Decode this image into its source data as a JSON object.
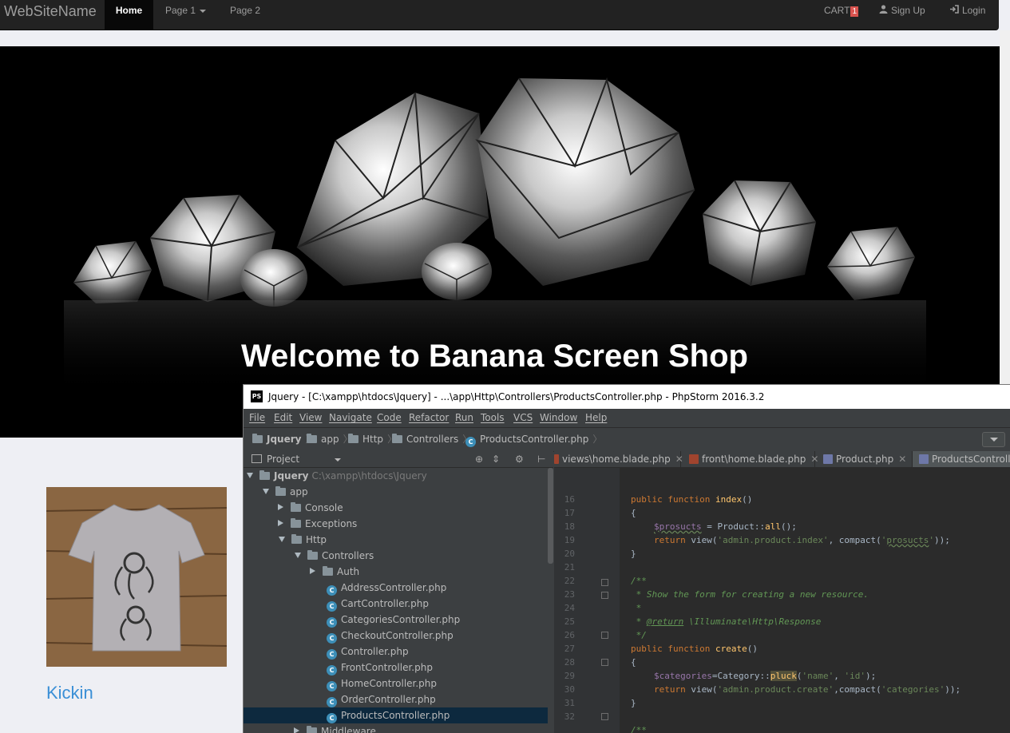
{
  "navbar": {
    "brand": "WebSiteName",
    "items": [
      "Home",
      "Page 1",
      "Page 2"
    ],
    "cart_label": "CART",
    "cart_count": "1",
    "signup": "Sign Up",
    "login": "Login"
  },
  "hero": {
    "title": "Welcome to Banana Screen Shop"
  },
  "product": {
    "name": "Kickin"
  },
  "ide": {
    "title": "Jquery - [C:\\xampp\\htdocs\\Jquery] - ...\\app\\Http\\Controllers\\ProductsController.php - PhpStorm 2016.3.2",
    "logo": "PS",
    "menu": [
      "File",
      "Edit",
      "View",
      "Navigate",
      "Code",
      "Refactor",
      "Run",
      "Tools",
      "VCS",
      "Window",
      "Help"
    ],
    "breadcrumb": [
      "Jquery",
      "app",
      "Http",
      "Controllers",
      "ProductsController.php"
    ],
    "project_label": "Project",
    "tabs": [
      "views\\home.blade.php",
      "front\\home.blade.php",
      "Product.php",
      "ProductsController"
    ],
    "tree": {
      "root": "Jquery",
      "root_path": "C:\\xampp\\htdocs\\Jquery",
      "app": "app",
      "console": "Console",
      "exceptions": "Exceptions",
      "http": "Http",
      "controllers": "Controllers",
      "auth": "Auth",
      "files": [
        "AddressController.php",
        "CartController.php",
        "CategoriesController.php",
        "CheckoutController.php",
        "Controller.php",
        "FrontController.php",
        "HomeController.php",
        "OrderController.php",
        "ProductsController.php"
      ],
      "middleware": "Middleware"
    },
    "line_numbers": [
      "16",
      "17",
      "18",
      "19",
      "20",
      "21",
      "22",
      "23",
      "24",
      "25",
      "26",
      "27",
      "28",
      "29",
      "30",
      "31",
      "32"
    ],
    "code": {
      "l16_kw": "public function ",
      "l16_fn": "index",
      "l16_rest": "()",
      "l17": "{",
      "l18_var": "$prosucts",
      "l18_mid": " = Product::",
      "l18_fn": "all",
      "l18_end": "();",
      "l19_kw": "return ",
      "l19_a": "view(",
      "l19_s1": "'admin.product.index'",
      "l19_b": ", compact(",
      "l19_s2q1": "'",
      "l19_s2": "prosucts",
      "l19_s2q2": "'",
      "l19_c": "));",
      "l20": "}",
      "l22": "/**",
      "l23": " * Show the form for creating a new resource.",
      "l24": " *",
      "l25_a": " * ",
      "l25_tag": "@return",
      "l25_b": " \\Illuminate\\Http\\Response",
      "l26": " */",
      "l27_kw": "public function ",
      "l27_fn": "create",
      "l27_rest": "()",
      "l28": "{",
      "l29_var": "$categories",
      "l29_mid": "=Category::",
      "l29_fn": "pluck",
      "l29_a": "(",
      "l29_s1": "'name'",
      "l29_b": ", ",
      "l29_s2": "'id'",
      "l29_c": ");",
      "l30_kw": "return ",
      "l30_a": "view(",
      "l30_s1": "'admin.product.create'",
      "l30_b": ",compact(",
      "l30_s2": "'categories'",
      "l30_c": "));",
      "l31": "}",
      "l33": "/**"
    }
  },
  "colors": {
    "navbar_bg": "#222222",
    "ide_bg": "#3c3f41",
    "editor_bg": "#2b2b2b",
    "link_blue": "#3a8fd6"
  }
}
